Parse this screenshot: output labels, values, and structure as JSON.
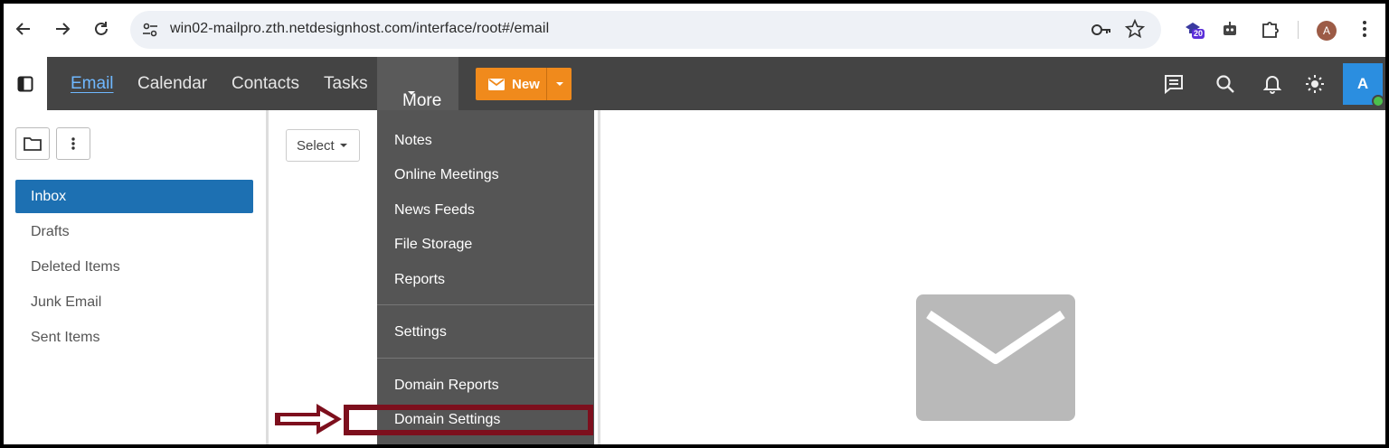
{
  "browser": {
    "url": "win02-mailpro.zth.netdesignhost.com/interface/root#/email",
    "extension_badge": "20",
    "profile_initial": "A"
  },
  "nav": {
    "email": "Email",
    "calendar": "Calendar",
    "contacts": "Contacts",
    "tasks": "Tasks",
    "more": "More",
    "new": "New"
  },
  "user_avatar": "A",
  "folders": {
    "items": [
      {
        "label": "Inbox",
        "active": true
      },
      {
        "label": "Drafts"
      },
      {
        "label": "Deleted Items"
      },
      {
        "label": "Junk Email"
      },
      {
        "label": "Sent Items"
      }
    ]
  },
  "list": {
    "select_label": "Select"
  },
  "more_menu": {
    "items": [
      "Notes",
      "Online Meetings",
      "News Feeds",
      "File Storage",
      "Reports",
      "Settings",
      "Domain Reports",
      "Domain Settings"
    ]
  },
  "colors": {
    "header_bg": "#444444",
    "accent_new": "#f08a1c",
    "active_folder": "#1d70b2",
    "annotation": "#7d0f1d"
  },
  "icons": [
    "back-icon",
    "forward-icon",
    "reload-icon",
    "site-settings-icon",
    "password-key-icon",
    "bookmark-star-icon",
    "extension-badge-icon",
    "robot-icon",
    "puzzle-icon",
    "chrome-menu-icon",
    "sidebar-toggle-icon",
    "chat-icon",
    "search-icon",
    "bell-icon",
    "theme-sun-icon",
    "folder-icon",
    "more-options-icon",
    "envelope-icon"
  ]
}
